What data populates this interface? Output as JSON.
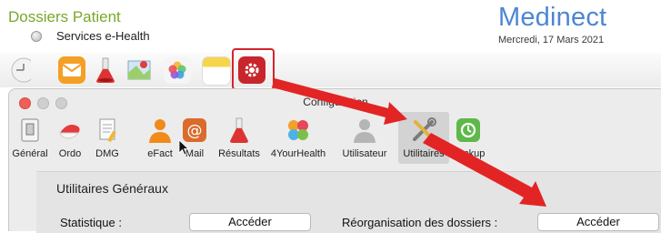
{
  "header": {
    "app_title": "Dossiers Patient",
    "services_label": "Services e-Health",
    "brand": "Medinect",
    "date": "Mercredi, 17 Mars 2021"
  },
  "toolbar": {
    "icons": [
      "clock-icon",
      "mail-icon",
      "flask-icon",
      "map-icon",
      "photos-icon",
      "notes-icon",
      "settings-gear-icon"
    ],
    "highlight_color": "#d6232b"
  },
  "dialog": {
    "title": "Configuration",
    "tabs": [
      {
        "label": "Général",
        "icon": "general-switch-icon"
      },
      {
        "label": "Ordo",
        "icon": "ordo-pill-icon"
      },
      {
        "label": "DMG",
        "icon": "dmg-document-icon"
      },
      {
        "label": "eFact",
        "icon": "efact-person-icon"
      },
      {
        "label": "Mail",
        "icon": "at-sign-icon"
      },
      {
        "label": "Résultats",
        "icon": "flask-icon"
      },
      {
        "label": "4YourHealth",
        "icon": "clover-icon"
      },
      {
        "label": "Utilisateur",
        "icon": "user-icon"
      },
      {
        "label": "Utilitaires",
        "icon": "tools-icon",
        "selected": true
      },
      {
        "label": "Backup",
        "icon": "backup-icon"
      }
    ],
    "section_title": "Utilitaires Généraux",
    "rows": [
      {
        "label": "Statistique :",
        "button": "Accéder"
      },
      {
        "label": "Réorganisation des dossiers :",
        "button": "Accéder"
      }
    ]
  },
  "annotation": {
    "arrow_color": "#e02020"
  }
}
